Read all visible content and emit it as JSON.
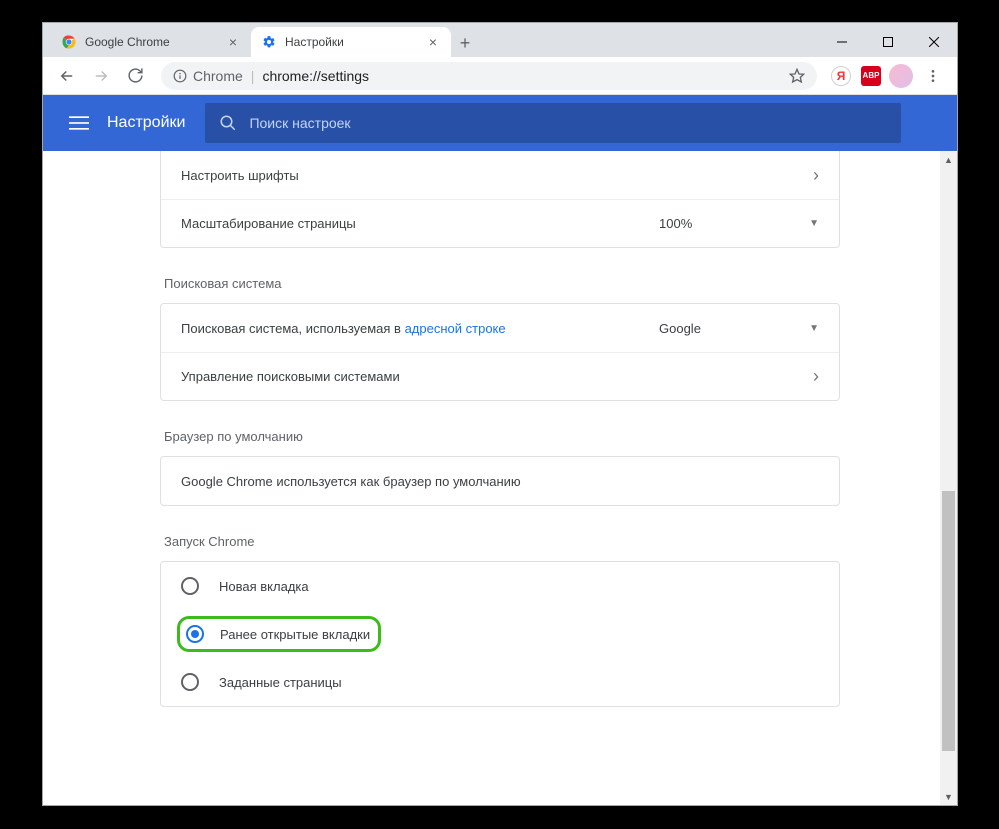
{
  "tabs": [
    {
      "title": "Google Chrome",
      "active": false
    },
    {
      "title": "Настройки",
      "active": true
    }
  ],
  "omnibox": {
    "scheme_label": "Chrome",
    "url": "chrome://settings"
  },
  "header": {
    "title": "Настройки",
    "search_placeholder": "Поиск настроек"
  },
  "sections": {
    "appearance_partial": {
      "customize_fonts": "Настроить шрифты",
      "page_zoom_label": "Масштабирование страницы",
      "page_zoom_value": "100%"
    },
    "search_engine": {
      "title": "Поисковая система",
      "used_in_prefix": "Поисковая система, используемая в ",
      "used_in_link": "адресной строке",
      "selected": "Google",
      "manage": "Управление поисковыми системами"
    },
    "default_browser": {
      "title": "Браузер по умолчанию",
      "status": "Google Chrome используется как браузер по умолчанию"
    },
    "on_startup": {
      "title": "Запуск Chrome",
      "options": [
        {
          "label": "Новая вкладка",
          "checked": false
        },
        {
          "label": "Ранее открытые вкладки",
          "checked": true,
          "highlight": true
        },
        {
          "label": "Заданные страницы",
          "checked": false
        }
      ]
    }
  }
}
